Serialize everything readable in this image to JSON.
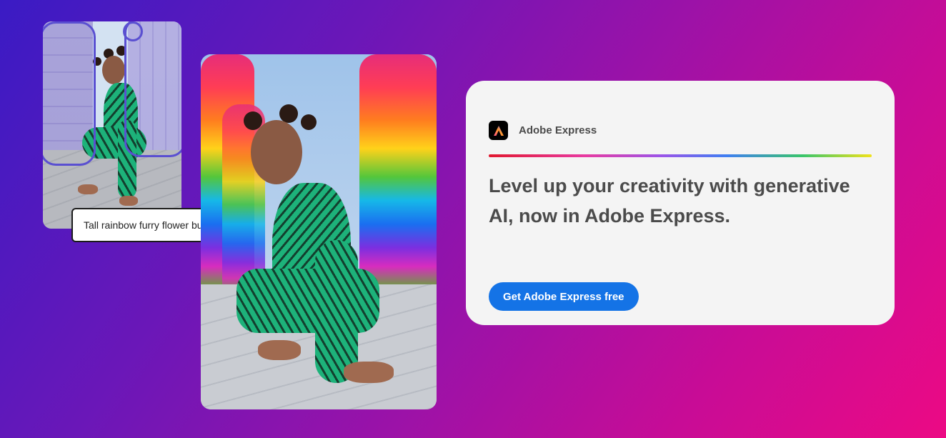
{
  "left_panel": {
    "source_photo": {
      "icon": "source-photo-woman-icon"
    },
    "prompt": {
      "text": "Tall rainbow furry flower building"
    },
    "generated_photo": {
      "icon": "generated-photo-rainbow-icon"
    }
  },
  "info_card": {
    "brand": {
      "name": "Adobe Express",
      "icon": "adobe-express-logo-icon"
    },
    "headline": "Level up your creativity with generative AI, now in Adobe Express.",
    "cta_label": "Get Adobe Express free"
  },
  "colors": {
    "cta": "#1473e6",
    "headline": "#4b4b4b",
    "card_bg": "#f4f4f4",
    "selection_outline": "#5a4fd1"
  }
}
